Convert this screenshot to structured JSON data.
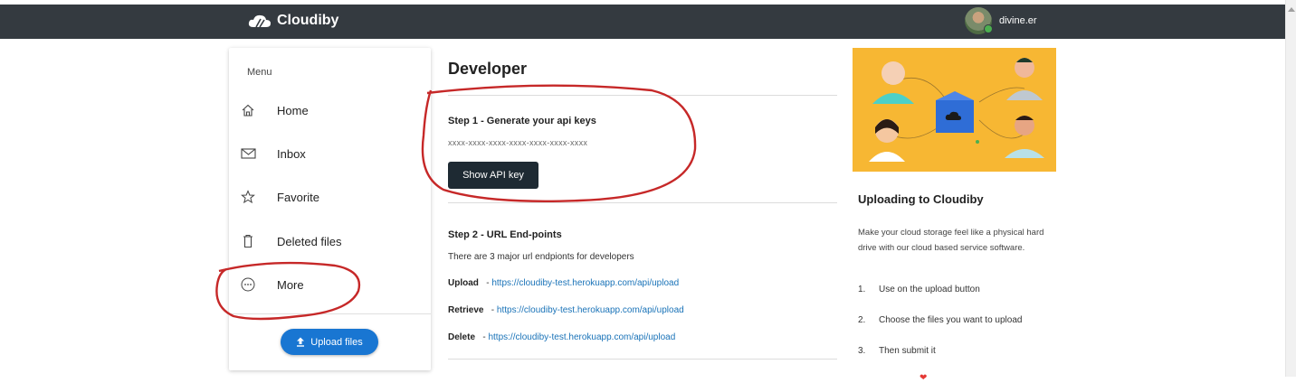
{
  "app": {
    "brand": "Cloudiby"
  },
  "user": {
    "name": "divine.er"
  },
  "sidebar": {
    "title": "Menu",
    "items": [
      {
        "label": "Home",
        "icon": "home-icon"
      },
      {
        "label": "Inbox",
        "icon": "mail-icon"
      },
      {
        "label": "Favorite",
        "icon": "star-icon"
      },
      {
        "label": "Deleted files",
        "icon": "trash-icon"
      },
      {
        "label": "More",
        "icon": "more-icon"
      }
    ],
    "upload_label": "Upload files"
  },
  "main": {
    "title": "Developer",
    "step1": {
      "heading": "Step 1 - Generate your api keys",
      "key_mask": "xxxx-xxxx-xxxx-xxxx-xxxx-xxxx-xxxx",
      "button_label": "Show API key"
    },
    "step2": {
      "heading": "Step 2 - URL End-points",
      "description": "There are 3 major url endpionts for developers",
      "endpoints": [
        {
          "name": "Upload",
          "url": "https://cloudiby-test.herokuapp.com/api/upload"
        },
        {
          "name": "Retrieve",
          "url": "https://cloudiby-test.herokuapp.com/api/upload"
        },
        {
          "name": "Delete",
          "url": "https://cloudiby-test.herokuapp.com/api/upload"
        }
      ]
    }
  },
  "aside": {
    "title": "Uploading to Cloudiby",
    "text": "Make your cloud storage feel like a physical hard drive with our cloud based service software.",
    "steps": [
      {
        "num": "1.",
        "text": "Use on the upload button"
      },
      {
        "num": "2.",
        "text": "Choose the files you want to upload"
      },
      {
        "num": "3.",
        "text": "Then submit it"
      }
    ]
  },
  "colors": {
    "navbar": "#343a40",
    "primary": "#1976d2",
    "link": "#1a73b8",
    "illustration_bg": "#f7b733",
    "annotation": "#c62828"
  }
}
